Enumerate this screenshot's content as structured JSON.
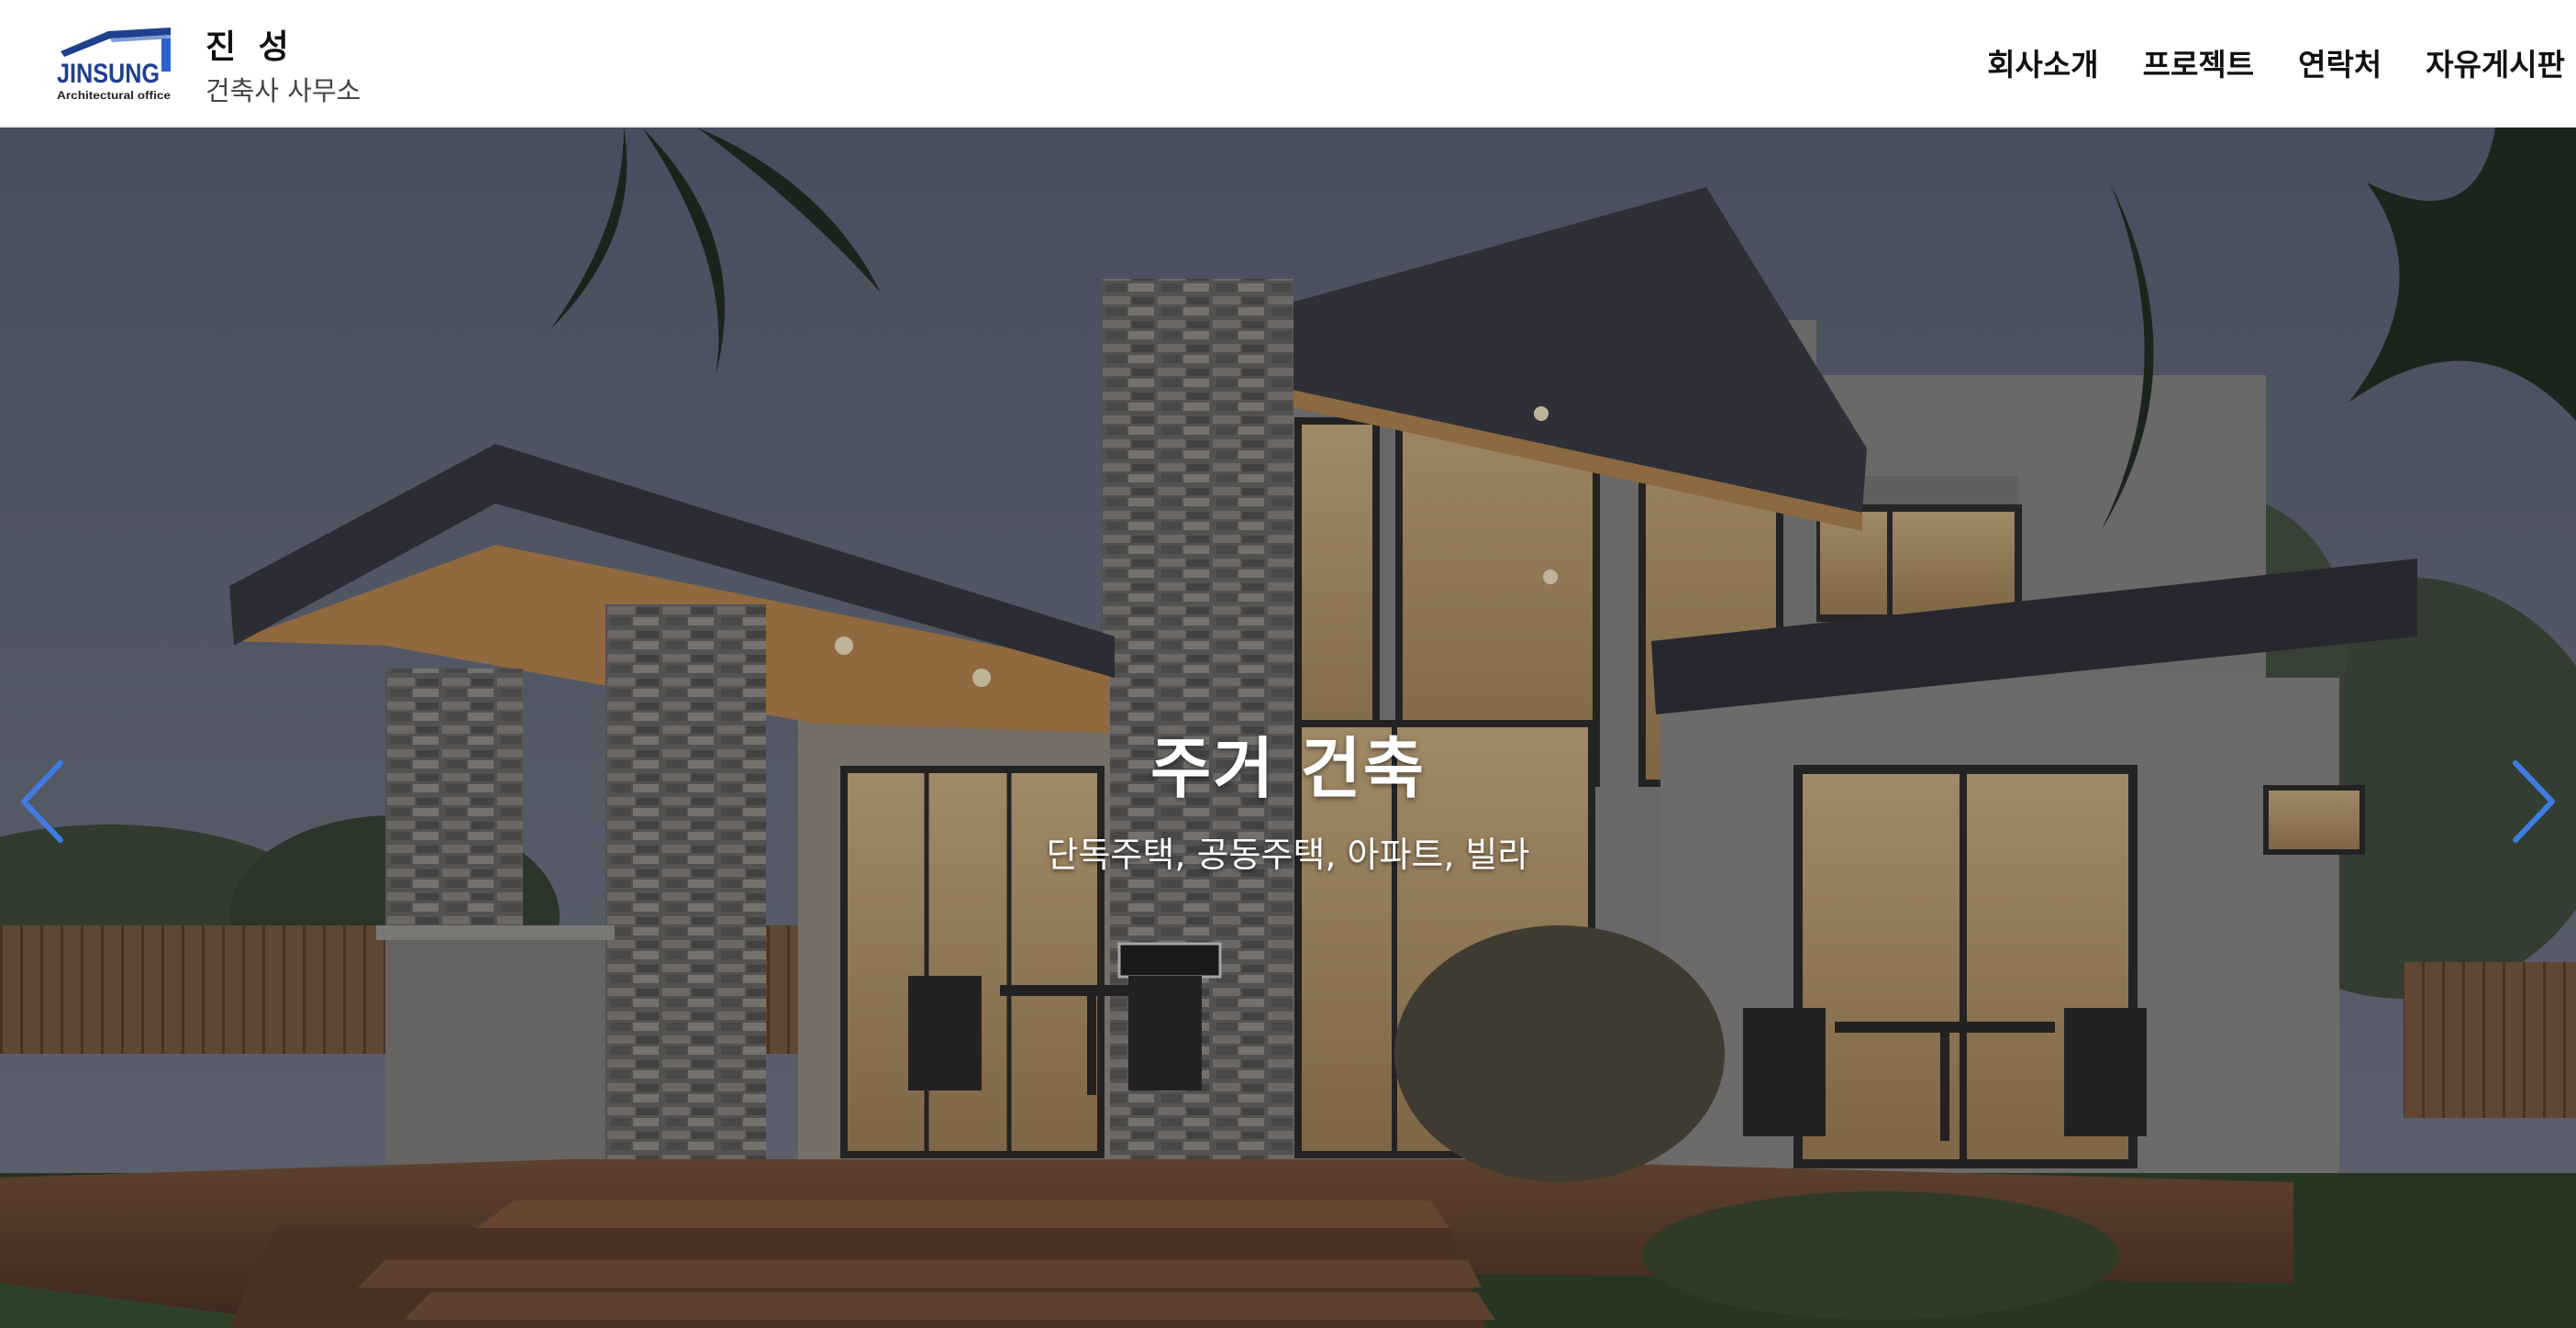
{
  "brand": {
    "logo_text": "JINSUNG",
    "logo_sub": "Architectural office",
    "name": "진 성",
    "subtitle": "건축사 사무소"
  },
  "nav": {
    "items": [
      {
        "label": "회사소개"
      },
      {
        "label": "프로젝트"
      },
      {
        "label": "연락처"
      },
      {
        "label": "자유게시판"
      }
    ]
  },
  "hero": {
    "title": "주거 건축",
    "subtitle": "단독주택, 공동주택, 아파트, 빌라",
    "prev_icon": "chevron-left-icon",
    "next_icon": "chevron-right-icon"
  },
  "colors": {
    "arrow": "#3f7be0",
    "logo_blue": "#1f3f8f",
    "logo_accent": "#2b63c9"
  }
}
